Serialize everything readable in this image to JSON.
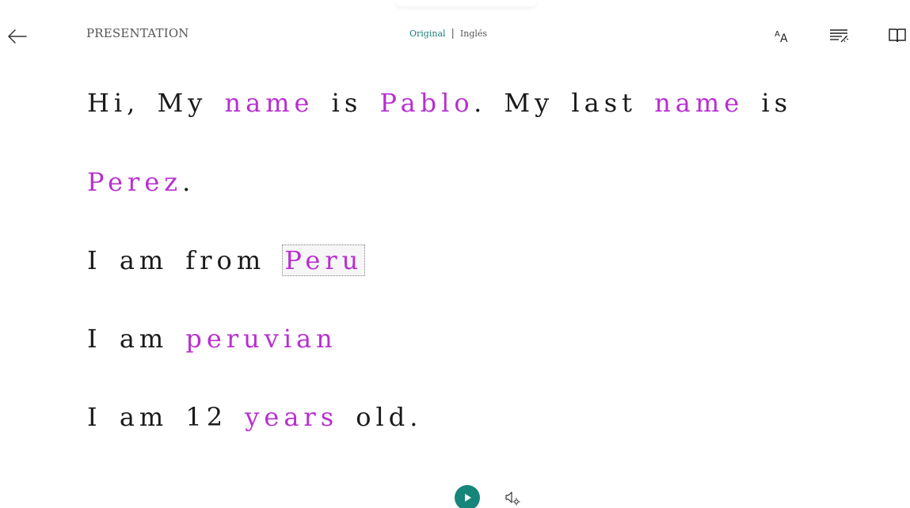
{
  "header": {
    "back_icon": "arrow-left-icon",
    "title": "PRESENTATION",
    "language_toggle": {
      "original": "Original",
      "separator": "|",
      "translation": "Inglés"
    },
    "tools": [
      {
        "icon": "text-preferences-icon"
      },
      {
        "icon": "grammar-options-icon"
      },
      {
        "icon": "reading-preferences-icon"
      }
    ]
  },
  "reader": {
    "line1": {
      "w1": "Hi, My ",
      "w2": "name",
      "w3": " is ",
      "w4": "Pablo",
      "w5": ". My last ",
      "w6": "name",
      "w7": " is"
    },
    "line2": {
      "w1": "Perez",
      "w2": "."
    },
    "line3": {
      "w1": "I am from ",
      "w2": "Peru"
    },
    "line4": {
      "w1": "I am ",
      "w2": "peruvian"
    },
    "line5": {
      "w1": "I am 12 ",
      "w2": "years",
      "w3": " old."
    },
    "highlight_color": "#b82fd1",
    "text_color": "#1a1a1a"
  },
  "footer": {
    "play_icon": "play-icon",
    "voice_settings_icon": "voice-settings-icon",
    "accent": "#16857a"
  }
}
